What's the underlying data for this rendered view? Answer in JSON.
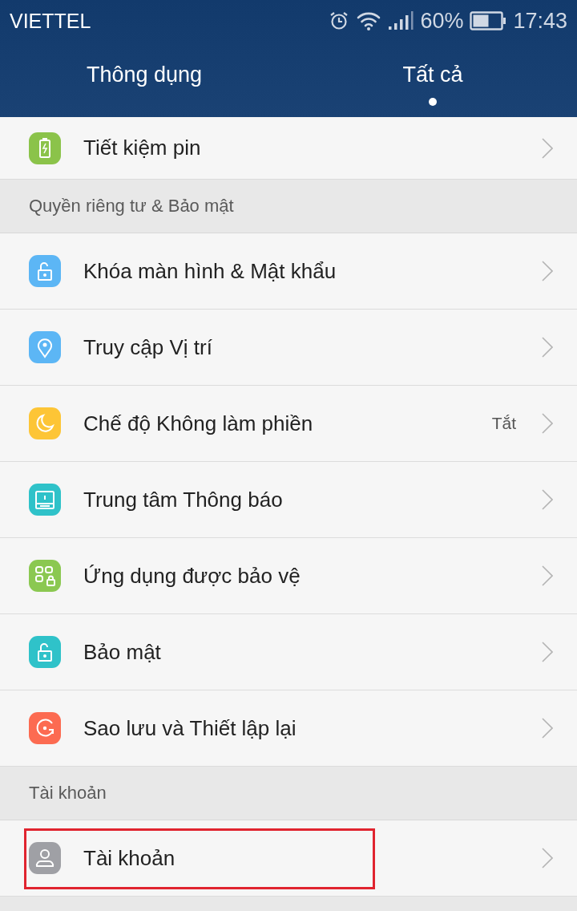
{
  "status_bar": {
    "carrier": "VIETTEL",
    "battery": "60%",
    "time": "17:43"
  },
  "tabs": [
    {
      "label": "Thông dụng",
      "selected": false
    },
    {
      "label": "Tất cả",
      "selected": true
    }
  ],
  "sections": [
    {
      "items": [
        {
          "kind": "battery",
          "label": "Tiết kiệm pin",
          "color": "#8bc34a",
          "highlighted": false
        }
      ]
    },
    {
      "header": "Quyền riêng tư & Bảo mật",
      "items": [
        {
          "kind": "lock",
          "label": "Khóa màn hình & Mật khẩu",
          "color": "#5cb6f5",
          "highlighted": false
        },
        {
          "kind": "location",
          "label": "Truy cập Vị trí",
          "color": "#5cb6f5",
          "highlighted": false
        },
        {
          "kind": "moon",
          "label": "Chế độ Không làm phiền",
          "value": "Tắt",
          "color": "#fdc536",
          "highlighted": false
        },
        {
          "kind": "notice",
          "label": "Trung tâm Thông báo",
          "color": "#2fc2c9",
          "highlighted": false
        },
        {
          "kind": "apps",
          "label": "Ứng dụng được bảo vệ",
          "color": "#8bc851",
          "highlighted": false
        },
        {
          "kind": "lock",
          "label": "Bảo mật",
          "color": "#2fc2c9",
          "highlighted": false
        },
        {
          "kind": "backup",
          "label": "Sao lưu và Thiết lập lại",
          "color": "#fc6b51",
          "highlighted": false
        }
      ]
    },
    {
      "header": "Tài khoản",
      "items": [
        {
          "kind": "person",
          "label": "Tài khoản",
          "color": "#9fa0a5",
          "highlighted": true
        }
      ]
    }
  ]
}
